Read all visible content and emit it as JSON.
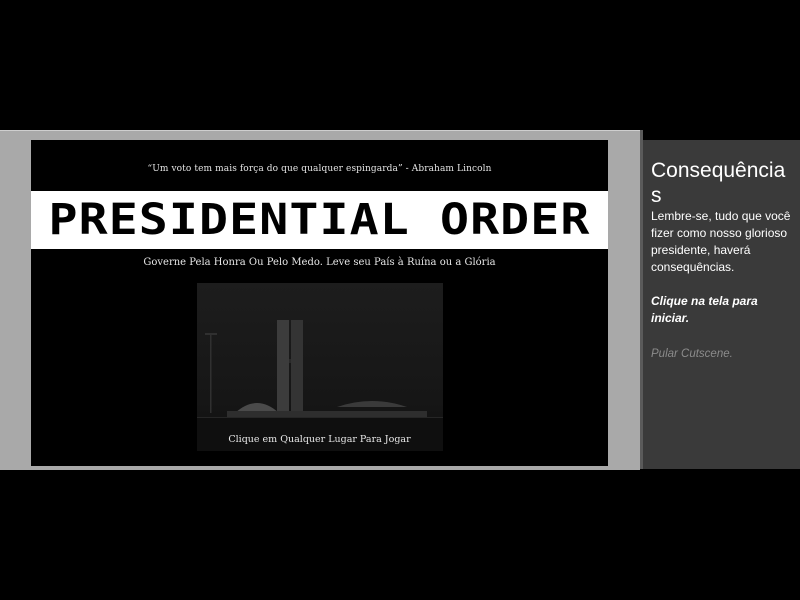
{
  "game": {
    "quote": "“Um voto tem mais força do que qualquer espingarda” - Abraham Lincoln",
    "title": "PRESIDENTIAL ORDER",
    "subtitle": "Governe Pela Honra Ou Pelo Medo. Leve seu País à Ruína ou a Glória",
    "click_prompt": "Clique em Qualquer Lugar Para Jogar"
  },
  "side_panel": {
    "title": "Consequências",
    "body": "Lembre-se, tudo que você fizer como nosso glorioso presidente, haverá consequências.",
    "start_hint": "Clique na tela para iniciar.",
    "skip_label": "Pular Cutscene."
  },
  "colors": {
    "page_background": "#000000",
    "stage_background": "#a9a9a9",
    "panel_background": "#3a3a3a",
    "skip_text": "#8b8b8b"
  }
}
